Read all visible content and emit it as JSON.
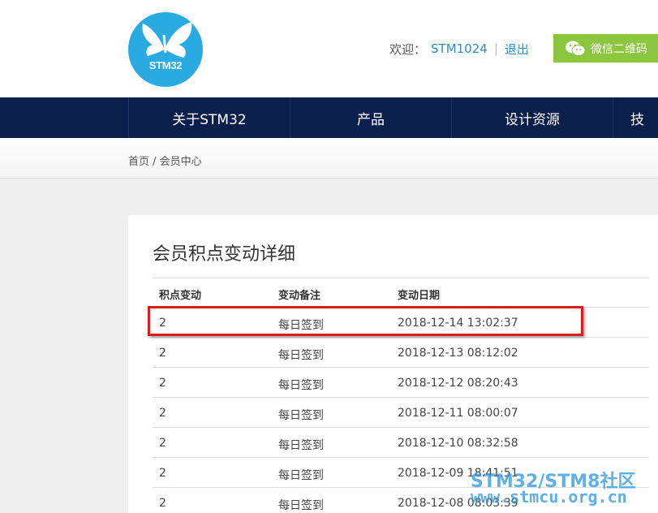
{
  "header": {
    "logo_text": "STM32",
    "welcome_label": "欢迎：",
    "username": "STM1024",
    "separator": "|",
    "logout_label": "退出",
    "wechat_label": "微信二维码"
  },
  "nav": {
    "items": [
      {
        "label": "关于STM32"
      },
      {
        "label": "产品"
      },
      {
        "label": "设计资源"
      },
      {
        "label": "技"
      }
    ]
  },
  "breadcrumb": {
    "text": "首页 / 会员中心"
  },
  "points_table": {
    "title": "会员积点变动详细",
    "columns": [
      "积点变动",
      "变动备注",
      "变动日期"
    ],
    "rows": [
      [
        "2",
        "每日签到",
        "2018-12-14 13:02:37"
      ],
      [
        "2",
        "每日签到",
        "2018-12-13 08:12:02"
      ],
      [
        "2",
        "每日签到",
        "2018-12-12 08:20:43"
      ],
      [
        "2",
        "每日签到",
        "2018-12-11 08:00:07"
      ],
      [
        "2",
        "每日签到",
        "2018-12-10 08:32:58"
      ],
      [
        "2",
        "每日签到",
        "2018-12-09 18:41:51"
      ],
      [
        "2",
        "每日签到",
        "2018-12-08 08:03:39"
      ]
    ]
  },
  "watermark": {
    "line1": "STM32/STM8社区",
    "line2": "www.stmcu.org.cn"
  },
  "colors": {
    "nav_bg": "#0b1f4d",
    "logo_bg": "#29abe2",
    "link": "#2a8ccf",
    "wechat_bg": "#8cc63f",
    "highlight": "#d81e1e"
  }
}
